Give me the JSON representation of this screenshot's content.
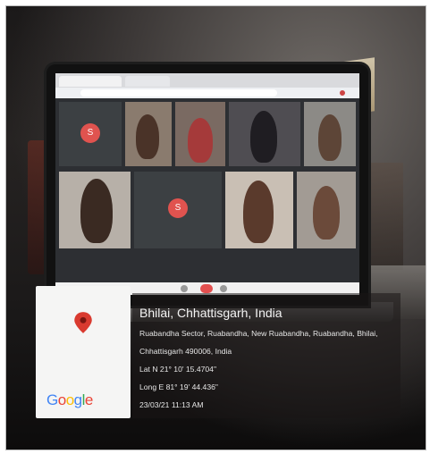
{
  "geotag": {
    "city": "Bhilai, Chhattisgarh, India",
    "address_line1": "Ruabandha Sector, Ruabandha, New Ruabandha, Ruabandha, Bhilai,",
    "address_line2": "Chhattisgarh 490006, India",
    "latitude": "Lat N 21° 10' 15.4704\"",
    "longitude": "Long E 81° 19' 44.436\"",
    "datetime": "23/03/21 11:13 AM",
    "brand": "Google",
    "pin_color": "#d93a2f"
  },
  "meeting": {
    "participant_initial": "S",
    "tile_avatar_color": "#e0534f"
  },
  "colors": {
    "google_blue": "#4285f4",
    "google_red": "#ea4335",
    "google_yellow": "#fbbc05",
    "google_green": "#34a853"
  }
}
